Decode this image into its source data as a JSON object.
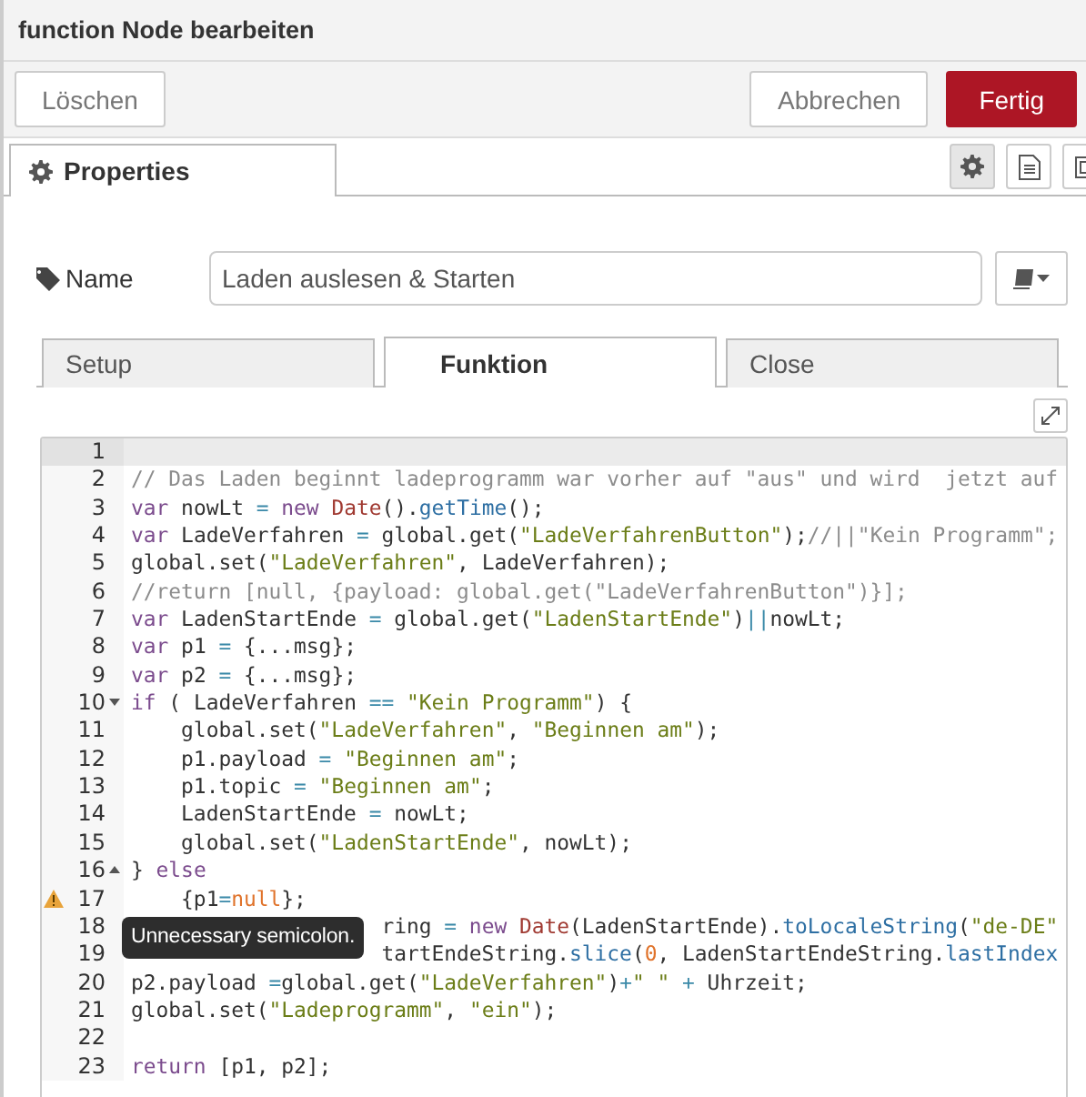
{
  "dialog": {
    "title": "function Node bearbeiten"
  },
  "left_buttons": [
    {
      "label": "Löschen",
      "kind": "plain"
    }
  ],
  "right_buttons": [
    {
      "label": "Abbrechen",
      "kind": "plain"
    },
    {
      "label": "Fertig",
      "kind": "primary"
    }
  ],
  "panel_tabs": [
    {
      "label": "Properties",
      "selected": true
    }
  ],
  "panel_icons": [
    {
      "kind": "gear",
      "selected": true
    },
    {
      "kind": "document",
      "selected": false
    },
    {
      "kind": "frame",
      "selected": false
    }
  ],
  "name_field": {
    "label": "Name",
    "value": "Laden auslesen & Starten"
  },
  "sub_tabs": [
    {
      "label": "Setup",
      "selected": false
    },
    {
      "label": "Funktion",
      "selected": true
    },
    {
      "label": "Close",
      "selected": false
    }
  ],
  "editor": {
    "lines": [
      {
        "number": "1",
        "active": true
      },
      {
        "number": "2",
        "active": false,
        "tokens": [
          {
            "kind": "com",
            "text": "// Das Laden beginnt ladeprogramm war vorher auf \"aus\" und wird  jetzt auf"
          }
        ]
      },
      {
        "number": "3",
        "active": false,
        "tokens": [
          {
            "kind": "kw",
            "text": "var"
          },
          {
            "kind": "p",
            "text": " nowLt "
          },
          {
            "kind": "op",
            "text": "="
          },
          {
            "kind": "kw",
            "text": " new"
          },
          {
            "kind": "ty",
            "text": " Date"
          },
          {
            "kind": "p",
            "text": "()."
          },
          {
            "kind": "fn",
            "text": "getTime"
          },
          {
            "kind": "p",
            "text": "();"
          }
        ]
      },
      {
        "number": "4",
        "active": false,
        "tokens": [
          {
            "kind": "kw",
            "text": "var"
          },
          {
            "kind": "p",
            "text": " LadeVerfahren "
          },
          {
            "kind": "op",
            "text": "="
          },
          {
            "kind": "p",
            "text": " global.get("
          },
          {
            "kind": "str",
            "text": "\"LadeVerfahrenButton\""
          },
          {
            "kind": "p",
            "text": ");"
          },
          {
            "kind": "com",
            "text": "//||\"Kein Programm\";"
          }
        ]
      },
      {
        "number": "5",
        "active": false,
        "tokens": [
          {
            "kind": "p",
            "text": "global.set("
          },
          {
            "kind": "str",
            "text": "\"LadeVerfahren\""
          },
          {
            "kind": "p",
            "text": ", LadeVerfahren);"
          }
        ]
      },
      {
        "number": "6",
        "active": false,
        "tokens": [
          {
            "kind": "com",
            "text": "//return [null, {payload: global.get(\"LadeVerfahrenButton\")}];"
          }
        ]
      },
      {
        "number": "7",
        "active": false,
        "tokens": [
          {
            "kind": "kw",
            "text": "var"
          },
          {
            "kind": "p",
            "text": " LadenStartEnde "
          },
          {
            "kind": "op",
            "text": "="
          },
          {
            "kind": "p",
            "text": " global.get("
          },
          {
            "kind": "str",
            "text": "\"LadenStartEnde\""
          },
          {
            "kind": "p",
            "text": ")"
          },
          {
            "kind": "op",
            "text": "||"
          },
          {
            "kind": "p",
            "text": "nowLt;"
          }
        ]
      },
      {
        "number": "8",
        "active": false,
        "tokens": [
          {
            "kind": "kw",
            "text": "var"
          },
          {
            "kind": "p",
            "text": " p1 "
          },
          {
            "kind": "op",
            "text": "="
          },
          {
            "kind": "p",
            "text": " {...msg};"
          }
        ]
      },
      {
        "number": "9",
        "active": false,
        "tokens": [
          {
            "kind": "kw",
            "text": "var"
          },
          {
            "kind": "p",
            "text": " p2 "
          },
          {
            "kind": "op",
            "text": "="
          },
          {
            "kind": "p",
            "text": " {...msg};"
          }
        ]
      },
      {
        "number": "10",
        "active": false,
        "marker": {
          "kind": "fold-open"
        },
        "tokens": [
          {
            "kind": "kw",
            "text": "if"
          },
          {
            "kind": "p",
            "text": " ( LadeVerfahren "
          },
          {
            "kind": "op",
            "text": "=="
          },
          {
            "kind": "str",
            "text": " \"Kein Programm\""
          },
          {
            "kind": "p",
            "text": ") {"
          }
        ]
      },
      {
        "number": "11",
        "active": false,
        "tokens": [
          {
            "kind": "p",
            "text": "    global.set("
          },
          {
            "kind": "str",
            "text": "\"LadeVerfahren\""
          },
          {
            "kind": "p",
            "text": ", "
          },
          {
            "kind": "str",
            "text": "\"Beginnen am\""
          },
          {
            "kind": "p",
            "text": ");"
          }
        ]
      },
      {
        "number": "12",
        "active": false,
        "tokens": [
          {
            "kind": "p",
            "text": "    p1.payload "
          },
          {
            "kind": "op",
            "text": "="
          },
          {
            "kind": "str",
            "text": " \"Beginnen am\""
          },
          {
            "kind": "p",
            "text": ";"
          }
        ]
      },
      {
        "number": "13",
        "active": false,
        "tokens": [
          {
            "kind": "p",
            "text": "    p1.topic "
          },
          {
            "kind": "op",
            "text": "="
          },
          {
            "kind": "str",
            "text": " \"Beginnen am\""
          },
          {
            "kind": "p",
            "text": ";"
          }
        ]
      },
      {
        "number": "14",
        "active": false,
        "tokens": [
          {
            "kind": "p",
            "text": "    LadenStartEnde "
          },
          {
            "kind": "op",
            "text": "="
          },
          {
            "kind": "p",
            "text": " nowLt;"
          }
        ]
      },
      {
        "number": "15",
        "active": false,
        "tokens": [
          {
            "kind": "p",
            "text": "    global.set("
          },
          {
            "kind": "str",
            "text": "\"LadenStartEnde\""
          },
          {
            "kind": "p",
            "text": ", nowLt);"
          }
        ]
      },
      {
        "number": "16",
        "active": false,
        "marker": {
          "kind": "fold-close"
        },
        "tokens": [
          {
            "kind": "p",
            "text": "} "
          },
          {
            "kind": "kw",
            "text": "else"
          }
        ]
      },
      {
        "number": "17",
        "active": false,
        "marker": {
          "kind": "warning"
        },
        "tooltip": "Unnecessary semicolon.",
        "tokens": [
          {
            "kind": "p",
            "text": "    {p1"
          },
          {
            "kind": "op",
            "text": "="
          },
          {
            "kind": "num",
            "text": "null"
          },
          {
            "kind": "p",
            "text": "};"
          }
        ]
      },
      {
        "number": "18",
        "active": false,
        "covered": true,
        "tokens": [
          {
            "kind": "p",
            "text": "ring "
          },
          {
            "kind": "op",
            "text": "="
          },
          {
            "kind": "kw",
            "text": " new"
          },
          {
            "kind": "ty",
            "text": " Date"
          },
          {
            "kind": "p",
            "text": "(LadenStartEnde)."
          },
          {
            "kind": "fn",
            "text": "toLocaleString"
          },
          {
            "kind": "p",
            "text": "("
          },
          {
            "kind": "str",
            "text": "\"de-DE\""
          }
        ]
      },
      {
        "number": "19",
        "active": false,
        "covered": true,
        "tokens": [
          {
            "kind": "p",
            "text": "tartEndeString."
          },
          {
            "kind": "fn",
            "text": "slice"
          },
          {
            "kind": "p",
            "text": "("
          },
          {
            "kind": "num",
            "text": "0"
          },
          {
            "kind": "p",
            "text": ", LadenStartEndeString."
          },
          {
            "kind": "fn",
            "text": "lastIndex"
          }
        ]
      },
      {
        "number": "20",
        "active": false,
        "tokens": [
          {
            "kind": "p",
            "text": "p2.payload "
          },
          {
            "kind": "op",
            "text": "="
          },
          {
            "kind": "p",
            "text": "global.get("
          },
          {
            "kind": "str",
            "text": "\"LadeVerfahren\""
          },
          {
            "kind": "p",
            "text": ")"
          },
          {
            "kind": "op",
            "text": "+"
          },
          {
            "kind": "str",
            "text": "\" \""
          },
          {
            "kind": "op",
            "text": " +"
          },
          {
            "kind": "p",
            "text": " Uhrzeit;"
          }
        ]
      },
      {
        "number": "21",
        "active": false,
        "tokens": [
          {
            "kind": "p",
            "text": "global.set("
          },
          {
            "kind": "str",
            "text": "\"Ladeprogramm\""
          },
          {
            "kind": "p",
            "text": ", "
          },
          {
            "kind": "str",
            "text": "\"ein\""
          },
          {
            "kind": "p",
            "text": ");"
          }
        ]
      },
      {
        "number": "22",
        "active": false
      },
      {
        "number": "23",
        "active": false,
        "tokens": [
          {
            "kind": "kw",
            "text": "return"
          },
          {
            "kind": "p",
            "text": " [p1, p2];"
          }
        ]
      }
    ]
  }
}
